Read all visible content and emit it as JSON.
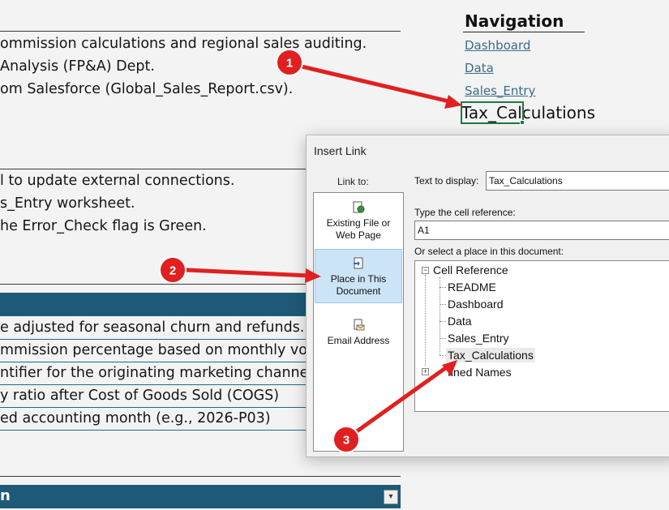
{
  "sheet": {
    "lines_top": [
      "ommission calculations and regional sales auditing.",
      "Analysis (FP&A) Dept.",
      "om Salesforce (Global_Sales_Report.csv)."
    ],
    "lines_mid": [
      "l to update external connections.",
      "s_Entry worksheet.",
      "he Error_Check flag is Green."
    ],
    "definitions": [
      "e adjusted for seasonal churn and refunds.",
      "mmission percentage based on monthly vo",
      "ntifier for the originating marketing channe",
      "y ratio after Cost of Goods Sold (COGS)",
      "ed accounting month (e.g., 2026-P03)"
    ],
    "bottom_band_label": "n"
  },
  "navigation": {
    "title": "Navigation",
    "links": [
      "Dashboard",
      "Data",
      "Sales_Entry"
    ],
    "editing_cell": "Tax_Calculations"
  },
  "dialog": {
    "title": "Insert Link",
    "link_to_label": "Link to:",
    "link_to_items": [
      {
        "label_line1": "Existing File or",
        "label_line2": "Web Page",
        "icon": "existing-file-icon"
      },
      {
        "label_line1": "Place in This",
        "label_line2": "Document",
        "icon": "place-in-document-icon"
      },
      {
        "label_line1": "Email Address",
        "label_line2": "",
        "icon": "email-address-icon"
      }
    ],
    "text_to_display_label": "Text to display:",
    "text_to_display_value": "Tax_Calculations",
    "cell_ref_label": "Type the cell reference:",
    "cell_ref_value": "A1",
    "place_label": "Or select a place in this document:",
    "tree": {
      "root": "Cell Reference",
      "sheets": [
        "README",
        "Dashboard",
        "Data",
        "Sales_Entry",
        "Tax_Calculations"
      ],
      "defined_names": "fined Names"
    }
  },
  "annotations": {
    "badges": [
      "1",
      "2",
      "3"
    ],
    "color": "#e02020"
  },
  "colors": {
    "band": "#1e5a78",
    "link": "#3b6b8a",
    "cell_border": "#1d7a44",
    "selected": "#cce4f7"
  }
}
